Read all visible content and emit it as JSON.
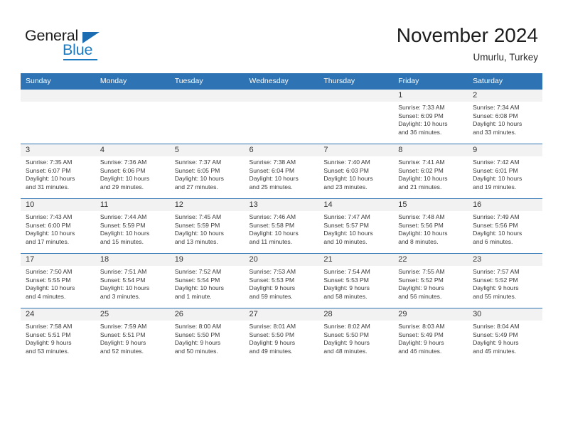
{
  "brand": {
    "name_part1": "General",
    "name_part2": "Blue",
    "accent_color": "#1b7ac0",
    "triangle_color": "#1b6cb0"
  },
  "header": {
    "title": "November 2024",
    "location": "Umurlu, Turkey"
  },
  "theme": {
    "header_row_bg": "#2e74b5",
    "daynum_band_bg": "#f2f2f2",
    "grid_line": "#2e74b5"
  },
  "weekday_headers": [
    "Sunday",
    "Monday",
    "Tuesday",
    "Wednesday",
    "Thursday",
    "Friday",
    "Saturday"
  ],
  "weeks": [
    [
      {
        "day": "",
        "sunrise": "",
        "sunset": "",
        "daylight1": "",
        "daylight2": "",
        "empty": true
      },
      {
        "day": "",
        "sunrise": "",
        "sunset": "",
        "daylight1": "",
        "daylight2": "",
        "empty": true
      },
      {
        "day": "",
        "sunrise": "",
        "sunset": "",
        "daylight1": "",
        "daylight2": "",
        "empty": true
      },
      {
        "day": "",
        "sunrise": "",
        "sunset": "",
        "daylight1": "",
        "daylight2": "",
        "empty": true
      },
      {
        "day": "",
        "sunrise": "",
        "sunset": "",
        "daylight1": "",
        "daylight2": "",
        "empty": true
      },
      {
        "day": "1",
        "sunrise": "Sunrise: 7:33 AM",
        "sunset": "Sunset: 6:09 PM",
        "daylight1": "Daylight: 10 hours",
        "daylight2": "and 36 minutes.",
        "empty": false
      },
      {
        "day": "2",
        "sunrise": "Sunrise: 7:34 AM",
        "sunset": "Sunset: 6:08 PM",
        "daylight1": "Daylight: 10 hours",
        "daylight2": "and 33 minutes.",
        "empty": false
      }
    ],
    [
      {
        "day": "3",
        "sunrise": "Sunrise: 7:35 AM",
        "sunset": "Sunset: 6:07 PM",
        "daylight1": "Daylight: 10 hours",
        "daylight2": "and 31 minutes.",
        "empty": false
      },
      {
        "day": "4",
        "sunrise": "Sunrise: 7:36 AM",
        "sunset": "Sunset: 6:06 PM",
        "daylight1": "Daylight: 10 hours",
        "daylight2": "and 29 minutes.",
        "empty": false
      },
      {
        "day": "5",
        "sunrise": "Sunrise: 7:37 AM",
        "sunset": "Sunset: 6:05 PM",
        "daylight1": "Daylight: 10 hours",
        "daylight2": "and 27 minutes.",
        "empty": false
      },
      {
        "day": "6",
        "sunrise": "Sunrise: 7:38 AM",
        "sunset": "Sunset: 6:04 PM",
        "daylight1": "Daylight: 10 hours",
        "daylight2": "and 25 minutes.",
        "empty": false
      },
      {
        "day": "7",
        "sunrise": "Sunrise: 7:40 AM",
        "sunset": "Sunset: 6:03 PM",
        "daylight1": "Daylight: 10 hours",
        "daylight2": "and 23 minutes.",
        "empty": false
      },
      {
        "day": "8",
        "sunrise": "Sunrise: 7:41 AM",
        "sunset": "Sunset: 6:02 PM",
        "daylight1": "Daylight: 10 hours",
        "daylight2": "and 21 minutes.",
        "empty": false
      },
      {
        "day": "9",
        "sunrise": "Sunrise: 7:42 AM",
        "sunset": "Sunset: 6:01 PM",
        "daylight1": "Daylight: 10 hours",
        "daylight2": "and 19 minutes.",
        "empty": false
      }
    ],
    [
      {
        "day": "10",
        "sunrise": "Sunrise: 7:43 AM",
        "sunset": "Sunset: 6:00 PM",
        "daylight1": "Daylight: 10 hours",
        "daylight2": "and 17 minutes.",
        "empty": false
      },
      {
        "day": "11",
        "sunrise": "Sunrise: 7:44 AM",
        "sunset": "Sunset: 5:59 PM",
        "daylight1": "Daylight: 10 hours",
        "daylight2": "and 15 minutes.",
        "empty": false
      },
      {
        "day": "12",
        "sunrise": "Sunrise: 7:45 AM",
        "sunset": "Sunset: 5:59 PM",
        "daylight1": "Daylight: 10 hours",
        "daylight2": "and 13 minutes.",
        "empty": false
      },
      {
        "day": "13",
        "sunrise": "Sunrise: 7:46 AM",
        "sunset": "Sunset: 5:58 PM",
        "daylight1": "Daylight: 10 hours",
        "daylight2": "and 11 minutes.",
        "empty": false
      },
      {
        "day": "14",
        "sunrise": "Sunrise: 7:47 AM",
        "sunset": "Sunset: 5:57 PM",
        "daylight1": "Daylight: 10 hours",
        "daylight2": "and 10 minutes.",
        "empty": false
      },
      {
        "day": "15",
        "sunrise": "Sunrise: 7:48 AM",
        "sunset": "Sunset: 5:56 PM",
        "daylight1": "Daylight: 10 hours",
        "daylight2": "and 8 minutes.",
        "empty": false
      },
      {
        "day": "16",
        "sunrise": "Sunrise: 7:49 AM",
        "sunset": "Sunset: 5:56 PM",
        "daylight1": "Daylight: 10 hours",
        "daylight2": "and 6 minutes.",
        "empty": false
      }
    ],
    [
      {
        "day": "17",
        "sunrise": "Sunrise: 7:50 AM",
        "sunset": "Sunset: 5:55 PM",
        "daylight1": "Daylight: 10 hours",
        "daylight2": "and 4 minutes.",
        "empty": false
      },
      {
        "day": "18",
        "sunrise": "Sunrise: 7:51 AM",
        "sunset": "Sunset: 5:54 PM",
        "daylight1": "Daylight: 10 hours",
        "daylight2": "and 3 minutes.",
        "empty": false
      },
      {
        "day": "19",
        "sunrise": "Sunrise: 7:52 AM",
        "sunset": "Sunset: 5:54 PM",
        "daylight1": "Daylight: 10 hours",
        "daylight2": "and 1 minute.",
        "empty": false
      },
      {
        "day": "20",
        "sunrise": "Sunrise: 7:53 AM",
        "sunset": "Sunset: 5:53 PM",
        "daylight1": "Daylight: 9 hours",
        "daylight2": "and 59 minutes.",
        "empty": false
      },
      {
        "day": "21",
        "sunrise": "Sunrise: 7:54 AM",
        "sunset": "Sunset: 5:53 PM",
        "daylight1": "Daylight: 9 hours",
        "daylight2": "and 58 minutes.",
        "empty": false
      },
      {
        "day": "22",
        "sunrise": "Sunrise: 7:55 AM",
        "sunset": "Sunset: 5:52 PM",
        "daylight1": "Daylight: 9 hours",
        "daylight2": "and 56 minutes.",
        "empty": false
      },
      {
        "day": "23",
        "sunrise": "Sunrise: 7:57 AM",
        "sunset": "Sunset: 5:52 PM",
        "daylight1": "Daylight: 9 hours",
        "daylight2": "and 55 minutes.",
        "empty": false
      }
    ],
    [
      {
        "day": "24",
        "sunrise": "Sunrise: 7:58 AM",
        "sunset": "Sunset: 5:51 PM",
        "daylight1": "Daylight: 9 hours",
        "daylight2": "and 53 minutes.",
        "empty": false
      },
      {
        "day": "25",
        "sunrise": "Sunrise: 7:59 AM",
        "sunset": "Sunset: 5:51 PM",
        "daylight1": "Daylight: 9 hours",
        "daylight2": "and 52 minutes.",
        "empty": false
      },
      {
        "day": "26",
        "sunrise": "Sunrise: 8:00 AM",
        "sunset": "Sunset: 5:50 PM",
        "daylight1": "Daylight: 9 hours",
        "daylight2": "and 50 minutes.",
        "empty": false
      },
      {
        "day": "27",
        "sunrise": "Sunrise: 8:01 AM",
        "sunset": "Sunset: 5:50 PM",
        "daylight1": "Daylight: 9 hours",
        "daylight2": "and 49 minutes.",
        "empty": false
      },
      {
        "day": "28",
        "sunrise": "Sunrise: 8:02 AM",
        "sunset": "Sunset: 5:50 PM",
        "daylight1": "Daylight: 9 hours",
        "daylight2": "and 48 minutes.",
        "empty": false
      },
      {
        "day": "29",
        "sunrise": "Sunrise: 8:03 AM",
        "sunset": "Sunset: 5:49 PM",
        "daylight1": "Daylight: 9 hours",
        "daylight2": "and 46 minutes.",
        "empty": false
      },
      {
        "day": "30",
        "sunrise": "Sunrise: 8:04 AM",
        "sunset": "Sunset: 5:49 PM",
        "daylight1": "Daylight: 9 hours",
        "daylight2": "and 45 minutes.",
        "empty": false
      }
    ]
  ]
}
